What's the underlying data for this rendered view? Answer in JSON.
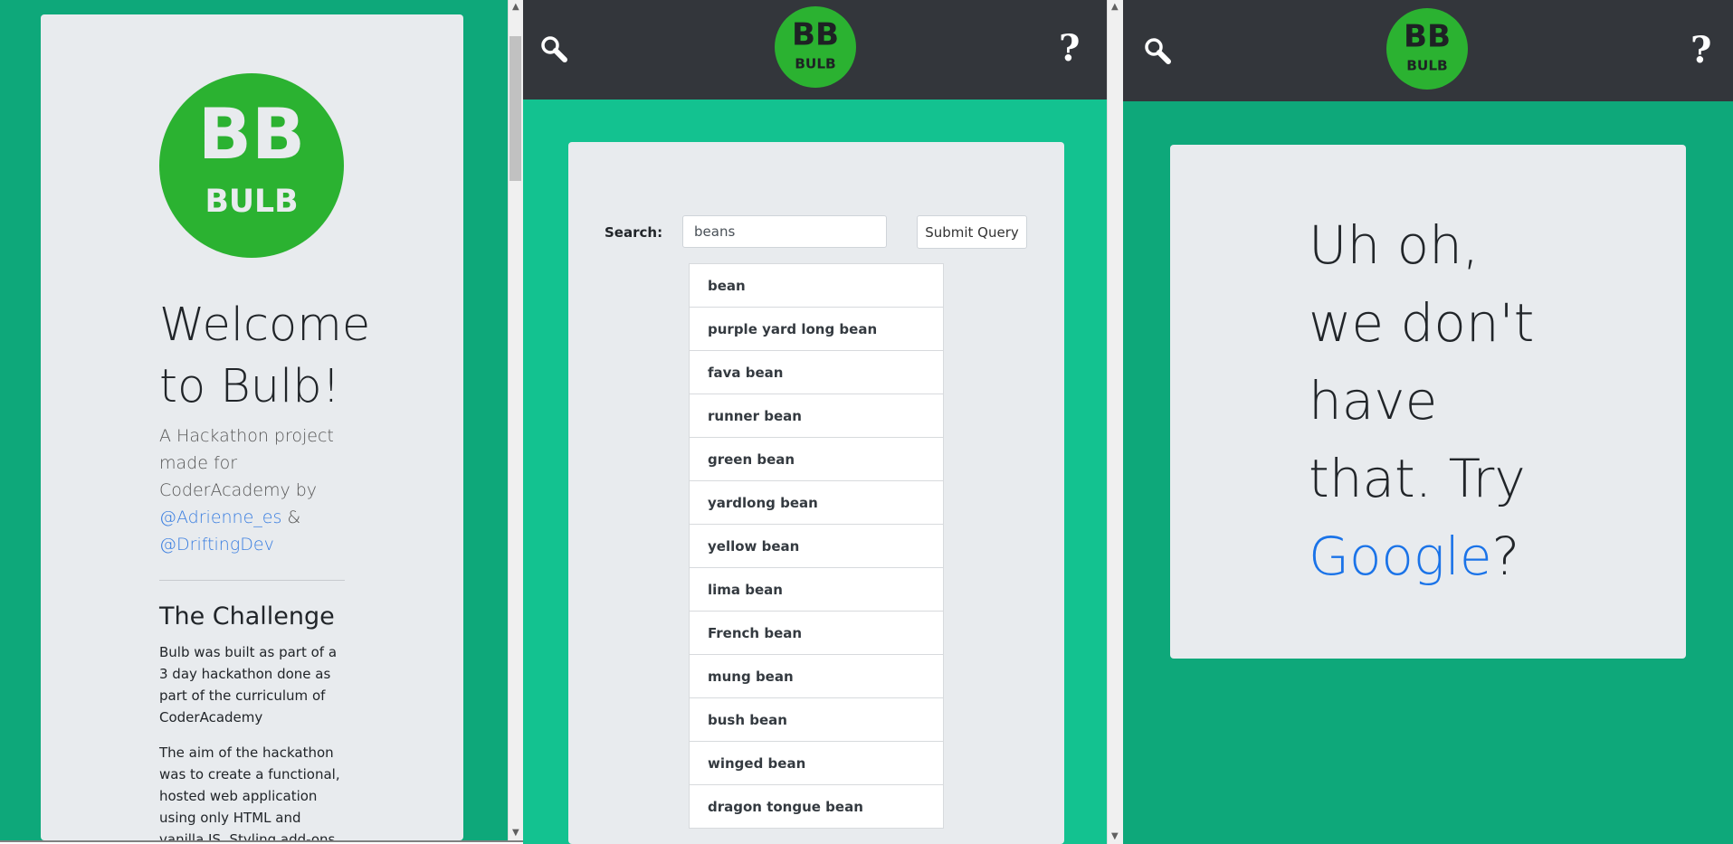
{
  "colors": {
    "page_green": "#0ea87a",
    "bright_green": "#13c290",
    "logo_green": "#2bb231",
    "navbar": "#33363b",
    "card": "#e8ebee",
    "link": "#1a73e8"
  },
  "logo": {
    "letters": "BB",
    "wordmark": "BULB"
  },
  "welcome_pane": {
    "title_line1": "Welcome",
    "title_line2": "to Bulb!",
    "intro_text": "A Hackathon project made for CoderAcademy by",
    "author1": "@Adrienne_es",
    "and_text": "&",
    "author2": "@DriftingDev",
    "section_heading": "The Challenge",
    "paragraph1": "Bulb was built as part of a 3 day hackathon done as part of the curriculum of CoderAcademy",
    "paragraph2": "The aim of the hackathon was to create a functional, hosted web application using only HTML and vanilla JS. Styling add-ons were also"
  },
  "search_pane": {
    "nav": {
      "search_icon": "magnifier-icon",
      "help_label": "?"
    },
    "search_label": "Search:",
    "search_value": "beans",
    "submit_label": "Submit Query",
    "results": [
      "bean",
      "purple yard long bean",
      "fava bean",
      "runner bean",
      "green bean",
      "yardlong bean",
      "yellow bean",
      "lima bean",
      "French bean",
      "mung bean",
      "bush bean",
      "winged bean",
      "dragon tongue bean"
    ]
  },
  "notfound_pane": {
    "nav": {
      "search_icon": "magnifier-icon",
      "help_label": "?"
    },
    "message_lines": [
      "Uh oh,",
      "we don't",
      "have",
      "that. Try"
    ],
    "link_text": "Google",
    "suffix": "?"
  }
}
